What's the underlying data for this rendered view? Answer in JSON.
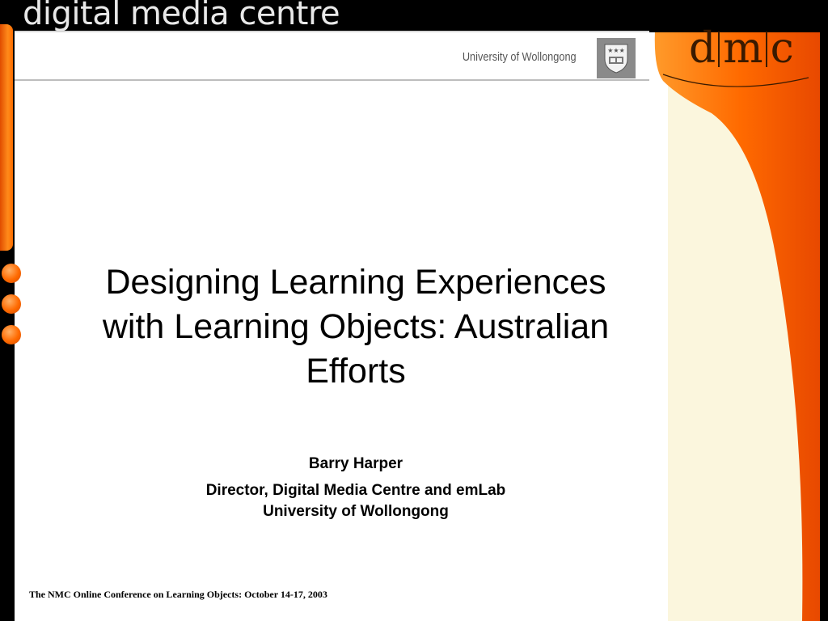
{
  "header": {
    "title": "digital media centre",
    "university": "University of Wollongong"
  },
  "logo": {
    "part1": "d",
    "part2": "m",
    "part3": "c"
  },
  "slide": {
    "title": "Designing Learning Experiences with Learning Objects: Australian Efforts",
    "author": "Barry Harper",
    "role_line1": "Director, Digital Media Centre and emLab",
    "role_line2": "University of Wollongong"
  },
  "footer": {
    "text": "The NMC Online Conference on Learning Objects: October 14-17, 2003"
  },
  "colors": {
    "accent_orange": "#ff6a00",
    "panel_cream": "#fbf6dd",
    "frame": "#000000"
  }
}
